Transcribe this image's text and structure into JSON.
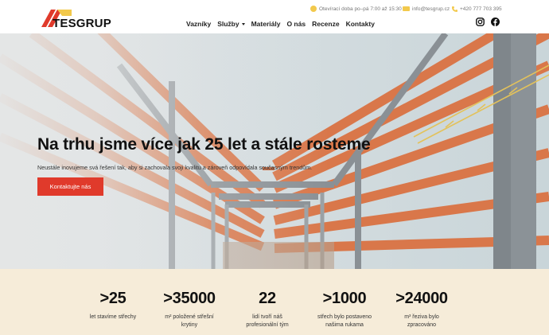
{
  "brand": {
    "name": "TESGRUP"
  },
  "topbar": {
    "hours": "Otevírací doba po–pá 7:00 až 15:30",
    "email": "info@tesgrup.cz",
    "phone": "+420 777 703 395"
  },
  "nav": {
    "items": [
      {
        "label": "Vazníky"
      },
      {
        "label": "Služby",
        "has_dropdown": true
      },
      {
        "label": "Materiály"
      },
      {
        "label": "O nás"
      },
      {
        "label": "Recenze"
      },
      {
        "label": "Kontakty"
      }
    ]
  },
  "social": {
    "icons": [
      "instagram-icon",
      "facebook-icon"
    ]
  },
  "hero": {
    "title": "Na trhu jsme více jak 25 let a stále rosteme",
    "subtitle": "Neustále inovujeme svá řešení tak, aby si zachovala svoji kvalitu a zároveň odpovídala současným trendům.",
    "cta_label": "Kontaktujte nás"
  },
  "stats": [
    {
      "value": ">25",
      "label_line1": "let stavíme střechy",
      "label_line2": ""
    },
    {
      "value": ">35000",
      "label_line1": "m² položené střešní",
      "label_line2": "krytiny"
    },
    {
      "value": "22",
      "label_line1": "lidí tvoří náš",
      "label_line2": "profesionální tým"
    },
    {
      "value": ">1000",
      "label_line1": "střech bylo postaveno",
      "label_line2": "našima rukama"
    },
    {
      "value": ">24000",
      "label_line1": "m³ řeziva bylo",
      "label_line2": "zpracováno"
    }
  ],
  "colors": {
    "accent": "#e03a2b",
    "logo_yellow": "#f2c94c",
    "stats_background": "#f6ecd9",
    "rafter_orange": "#d9774a",
    "steel_grey": "#8a9095"
  }
}
